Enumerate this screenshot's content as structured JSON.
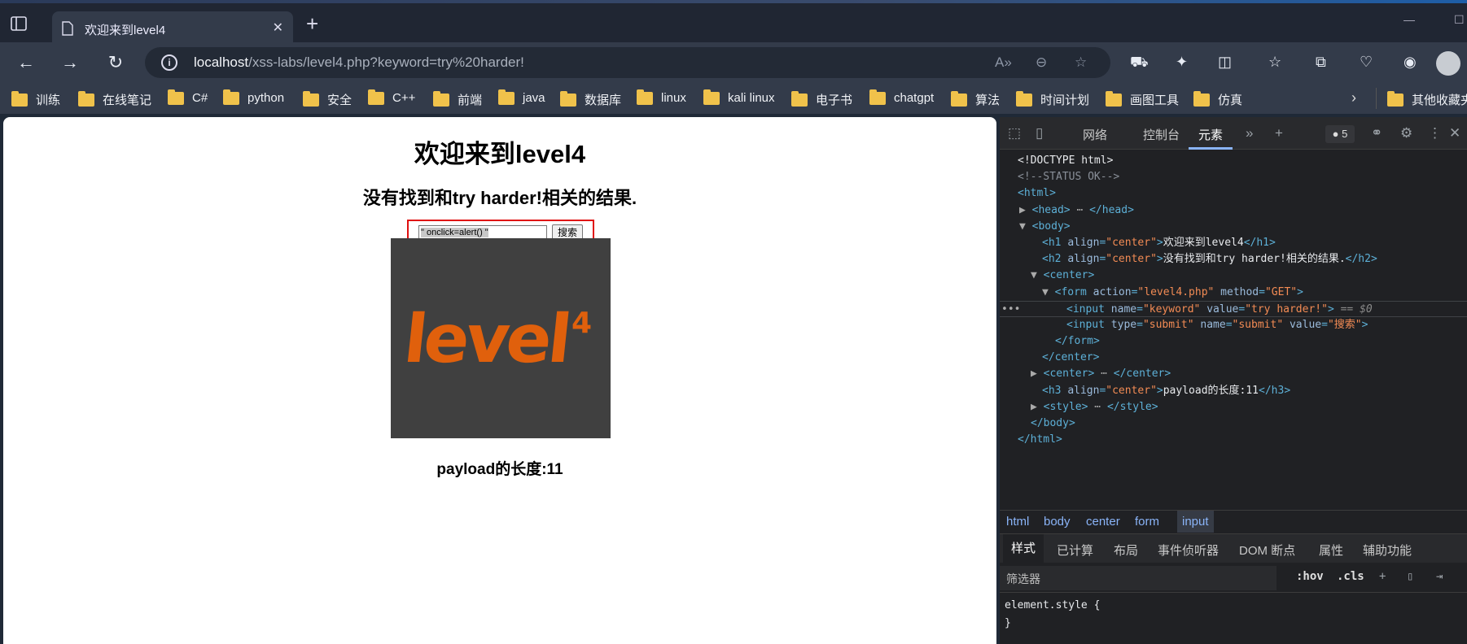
{
  "browser": {
    "tab_title": "欢迎来到level4",
    "new_tab_symbol": "+",
    "close_symbol": "✕",
    "url_host": "localhost",
    "url_path": "/xss-labs/level4.php?keyword=try%20harder!",
    "bookmarks": [
      "训练",
      "在线笔记",
      "C#",
      "python",
      "安全",
      "C++",
      "前端",
      "java",
      "数据库",
      "linux",
      "kali linux",
      "电子书",
      "chatgpt",
      "算法",
      "时间计划",
      "画图工具",
      "仿真"
    ],
    "bookmark_overflow": "其他收藏夹"
  },
  "page": {
    "h1": "欢迎来到level4",
    "h2": "没有找到和try harder!相关的结果.",
    "keyword_value": "\" onclick=alert() \"",
    "submit_label": "搜索",
    "logo_text": "level",
    "logo_sup": "4",
    "h3": "payload的长度:11"
  },
  "devtools": {
    "tabs": [
      "网络",
      "控制台",
      "元素"
    ],
    "active_tab": "元素",
    "badge_count": "5",
    "breadcrumbs": [
      "html",
      "body",
      "center",
      "form",
      "input"
    ],
    "sub_tabs": [
      "样式",
      "已计算",
      "布局",
      "事件侦听器",
      "DOM 断点",
      "属性",
      "辅助功能"
    ],
    "filter_placeholder": "筛选器",
    "hov": ":hov",
    "cls": ".cls",
    "style_selector": "element.style {",
    "style_close": "}",
    "dom": {
      "doctype": "<!DOCTYPE html>",
      "comment": "<!--STATUS OK-->",
      "h1_text": "欢迎来到level4",
      "h2_text": "没有找到和try harder!相关的结果.",
      "form_action": "\"level4.php\"",
      "form_method": "\"GET\"",
      "input_name": "\"keyword\"",
      "input_value": "\"try harder!\"",
      "selected_marker": "== $0",
      "submit_type": "\"submit\"",
      "submit_name": "\"submit\"",
      "submit_value": "\"搜索\"",
      "h3_text": "payload的长度:11",
      "align_center": "\"center\""
    }
  }
}
